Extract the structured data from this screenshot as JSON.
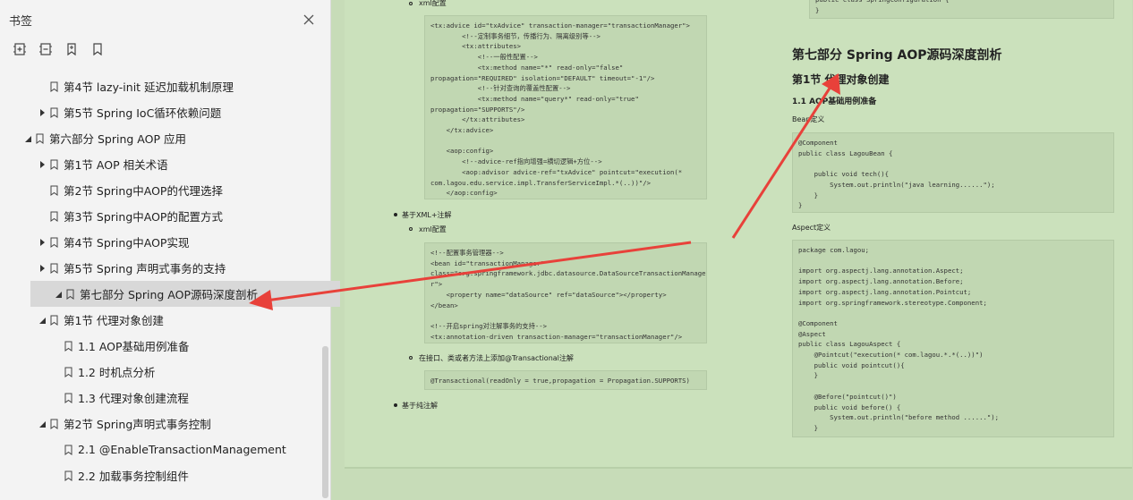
{
  "sidebar": {
    "title": "书签",
    "tree": [
      {
        "label": "第4节 lazy-init 延迟加载机制原理",
        "level": 2,
        "arrow": "none"
      },
      {
        "label": "第5节 Spring IoC循环依赖问题",
        "level": 2,
        "arrow": "right"
      },
      {
        "label": "第六部分 Spring AOP 应用",
        "level": 1,
        "arrow": "down"
      },
      {
        "label": "第1节 AOP 相关术语",
        "level": 2,
        "arrow": "right"
      },
      {
        "label": "第2节 Spring中AOP的代理选择",
        "level": 2,
        "arrow": "none"
      },
      {
        "label": "第3节 Spring中AOP的配置方式",
        "level": 2,
        "arrow": "none"
      },
      {
        "label": "第4节 Spring中AOP实现",
        "level": 2,
        "arrow": "right"
      },
      {
        "label": "第5节 Spring 声明式事务的支持",
        "level": 2,
        "arrow": "right"
      },
      {
        "label": "第七部分 Spring AOP源码深度剖析",
        "level": 1,
        "arrow": "down",
        "selected": true
      },
      {
        "label": "第1节 代理对象创建",
        "level": 2,
        "arrow": "down"
      },
      {
        "label": "1.1 AOP基础用例准备",
        "level": 3,
        "arrow": "none"
      },
      {
        "label": "1.2 时机点分析",
        "level": 3,
        "arrow": "none"
      },
      {
        "label": "1.3 代理对象创建流程",
        "level": 3,
        "arrow": "none"
      },
      {
        "label": "第2节 Spring声明式事务控制",
        "level": 2,
        "arrow": "down"
      },
      {
        "label": "2.1 @EnableTransactionManagement",
        "level": 3,
        "arrow": "none"
      },
      {
        "label": "2.2 加载事务控制组件",
        "level": 3,
        "arrow": "none"
      }
    ]
  },
  "doc": {
    "left": {
      "xml_config_label": "xml配置",
      "code1": "<tx:advice id=\"txAdvice\" transaction-manager=\"transactionManager\">\n        <!--定制事务细节，传播行为、隔离级别等-->\n        <tx:attributes>\n            <!--一般性配置-->\n            <tx:method name=\"*\" read-only=\"false\"\npropagation=\"REQUIRED\" isolation=\"DEFAULT\" timeout=\"-1\"/>\n            <!--针对查询的覆盖性配置-->\n            <tx:method name=\"query*\" read-only=\"true\"\npropagation=\"SUPPORTS\"/>\n        </tx:attributes>\n    </tx:advice>\n\n    <aop:config>\n        <!--advice-ref指向增强=横切逻辑+方位-->\n        <aop:advisor advice-ref=\"txAdvice\" pointcut=\"execution(*\ncom.lagou.edu.service.impl.TransferServiceImpl.*(..))\"/>\n    </aop:config>",
      "bullet_xml_annotation": "基于XML+注解",
      "xml_config_label2": "xml配置",
      "code2": "<!--配置事务管理器-->\n<bean id=\"transactionManager\"\nclass=\"org.springframework.jdbc.datasource.DataSourceTransactionManage\nr\">\n    <property name=\"dataSource\" ref=\"dataSource\"></property>\n</bean>\n\n<!--开启spring对注解事务的支持-->\n<tx:annotation-driven transaction-manager=\"transactionManager\"/>",
      "annotation_tip": "在接口、类或者方法上添加@Transactional注解",
      "code3": "@Transactional(readOnly = true,propagation = Propagation.SUPPORTS)",
      "bullet_pure_annotation": "基于纯注解"
    },
    "right": {
      "code_top": "public class SpringConfiguration {\n}",
      "h2": "第七部分 Spring AOP源码深度剖析",
      "h3": "第1节 代理对象创建",
      "h4": "1.1 AOP基础用例准备",
      "bean_label": "Bean定义",
      "code_bean": "@Component\npublic class LagouBean {\n\n    public void tech(){\n        System.out.println(\"java learning......\");\n    }\n}",
      "aspect_label": "Aspect定义",
      "code_aspect": "package com.lagou;\n\nimport org.aspectj.lang.annotation.Aspect;\nimport org.aspectj.lang.annotation.Before;\nimport org.aspectj.lang.annotation.Pointcut;\nimport org.springframework.stereotype.Component;\n\n@Component\n@Aspect\npublic class LagouAspect {\n    @Pointcut(\"execution(* com.lagou.*.*(..))\")\n    public void pointcut(){\n    }\n\n    @Before(\"pointcut()\")\n    public void before() {\n        System.out.println(\"before method ......\");\n    }"
    }
  },
  "colors": {
    "annotation_arrow": "#e8413a",
    "page_background": "#cbe1bc",
    "sidebar_background": "#f3f3f3"
  }
}
